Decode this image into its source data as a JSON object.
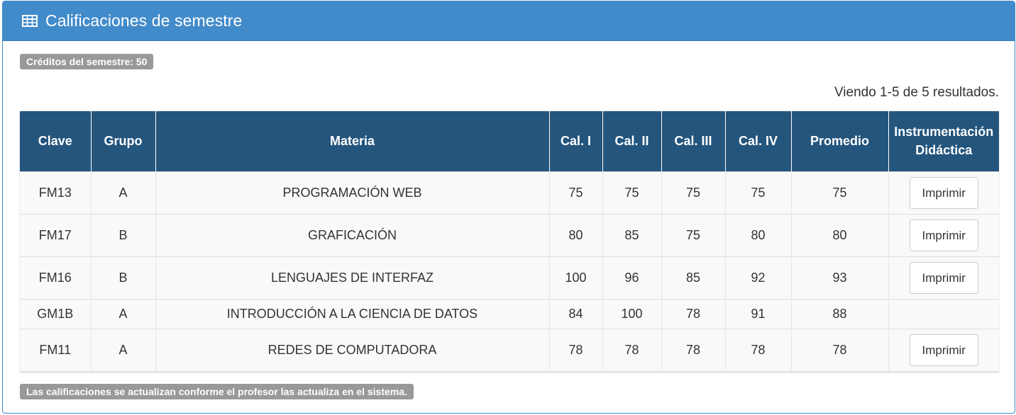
{
  "panel": {
    "icon": "table-icon",
    "title": "Calificaciones de semestre"
  },
  "credits_badge": "Créditos del semestre: 50",
  "summary_text": "Viendo 1-5 de 5 resultados.",
  "table": {
    "headers": {
      "clave": "Clave",
      "grupo": "Grupo",
      "materia": "Materia",
      "cal1": "Cal. I",
      "cal2": "Cal. II",
      "cal3": "Cal. III",
      "cal4": "Cal. IV",
      "promedio": "Promedio",
      "instrumentacion_line1": "Instrumentación",
      "instrumentacion_line2": "Didáctica"
    },
    "rows": [
      {
        "clave": "FM13",
        "grupo": "A",
        "materia": "PROGRAMACIÓN WEB",
        "cal1": "75",
        "cal2": "75",
        "cal3": "75",
        "cal4": "75",
        "promedio": "75",
        "action": "Imprimir"
      },
      {
        "clave": "FM17",
        "grupo": "B",
        "materia": "GRAFICACIÓN",
        "cal1": "80",
        "cal2": "85",
        "cal3": "75",
        "cal4": "80",
        "promedio": "80",
        "action": "Imprimir"
      },
      {
        "clave": "FM16",
        "grupo": "B",
        "materia": "LENGUAJES DE INTERFAZ",
        "cal1": "100",
        "cal2": "96",
        "cal3": "85",
        "cal4": "92",
        "promedio": "93",
        "action": "Imprimir"
      },
      {
        "clave": "GM1B",
        "grupo": "A",
        "materia": "INTRODUCCIÓN A LA CIENCIA DE DATOS",
        "cal1": "84",
        "cal2": "100",
        "cal3": "78",
        "cal4": "91",
        "promedio": "88",
        "action": ""
      },
      {
        "clave": "FM11",
        "grupo": "A",
        "materia": "REDES DE COMPUTADORA",
        "cal1": "78",
        "cal2": "78",
        "cal3": "78",
        "cal4": "78",
        "promedio": "78",
        "action": "Imprimir"
      }
    ]
  },
  "footer_note": "Las calificaciones se actualizan conforme el profesor las actualiza en el sistema.",
  "colors": {
    "header_bar": "#428bca",
    "table_header": "#24557d",
    "badge": "#999999"
  }
}
